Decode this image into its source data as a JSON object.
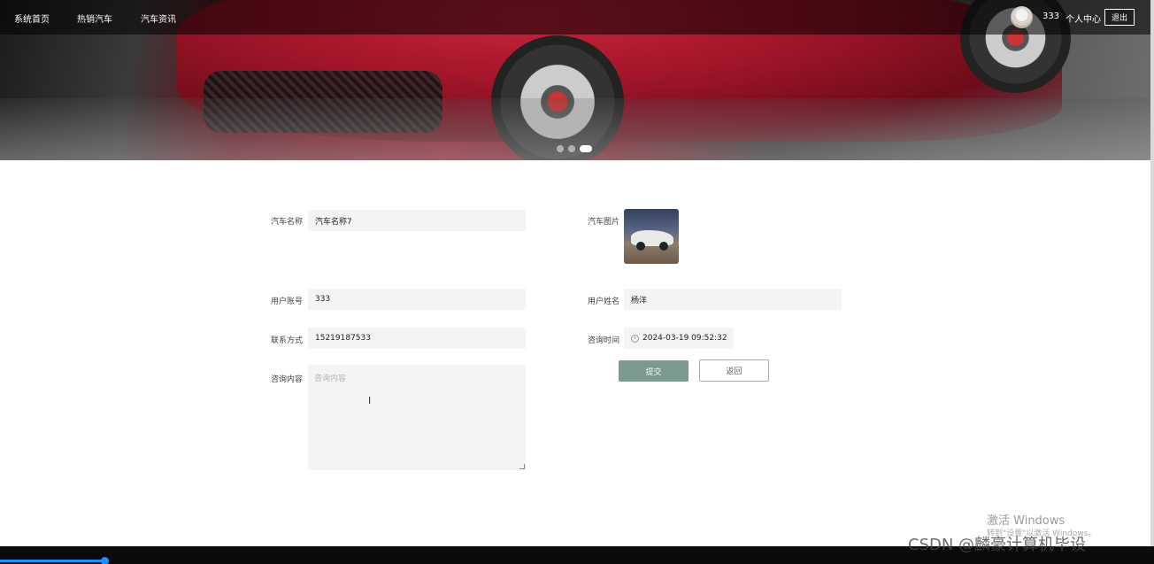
{
  "nav": {
    "items": [
      "系统首页",
      "热销汽车",
      "汽车资讯"
    ],
    "username": "333",
    "profile_label": "个人中心",
    "logout_label": "退出"
  },
  "banner": {
    "dots_total": 3,
    "active_dot": 3
  },
  "form": {
    "car_name": {
      "label": "汽车名称",
      "value": "汽车名称7"
    },
    "car_image": {
      "label": "汽车图片"
    },
    "user_account": {
      "label": "用户账号",
      "value": "333"
    },
    "user_name": {
      "label": "用户姓名",
      "value": "杨洋"
    },
    "contact": {
      "label": "联系方式",
      "value": "15219187533"
    },
    "consult_time": {
      "label": "咨询时间",
      "value": "2024-03-19 09:52:32"
    },
    "consult_content": {
      "label": "咨询内容",
      "placeholder": "咨询内容"
    },
    "submit_label": "提交",
    "back_label": "返回"
  },
  "watermarks": {
    "activate_title": "激活 Windows",
    "activate_sub": "转到\"设置\"以激活 Windows。",
    "csdn": "CSDN @麟豪计算机毕设"
  },
  "colors": {
    "submit_bg": "#7b9a8d",
    "nav_bg": "rgba(0,0,0,0.55)",
    "field_bg": "#f4f4f4"
  }
}
